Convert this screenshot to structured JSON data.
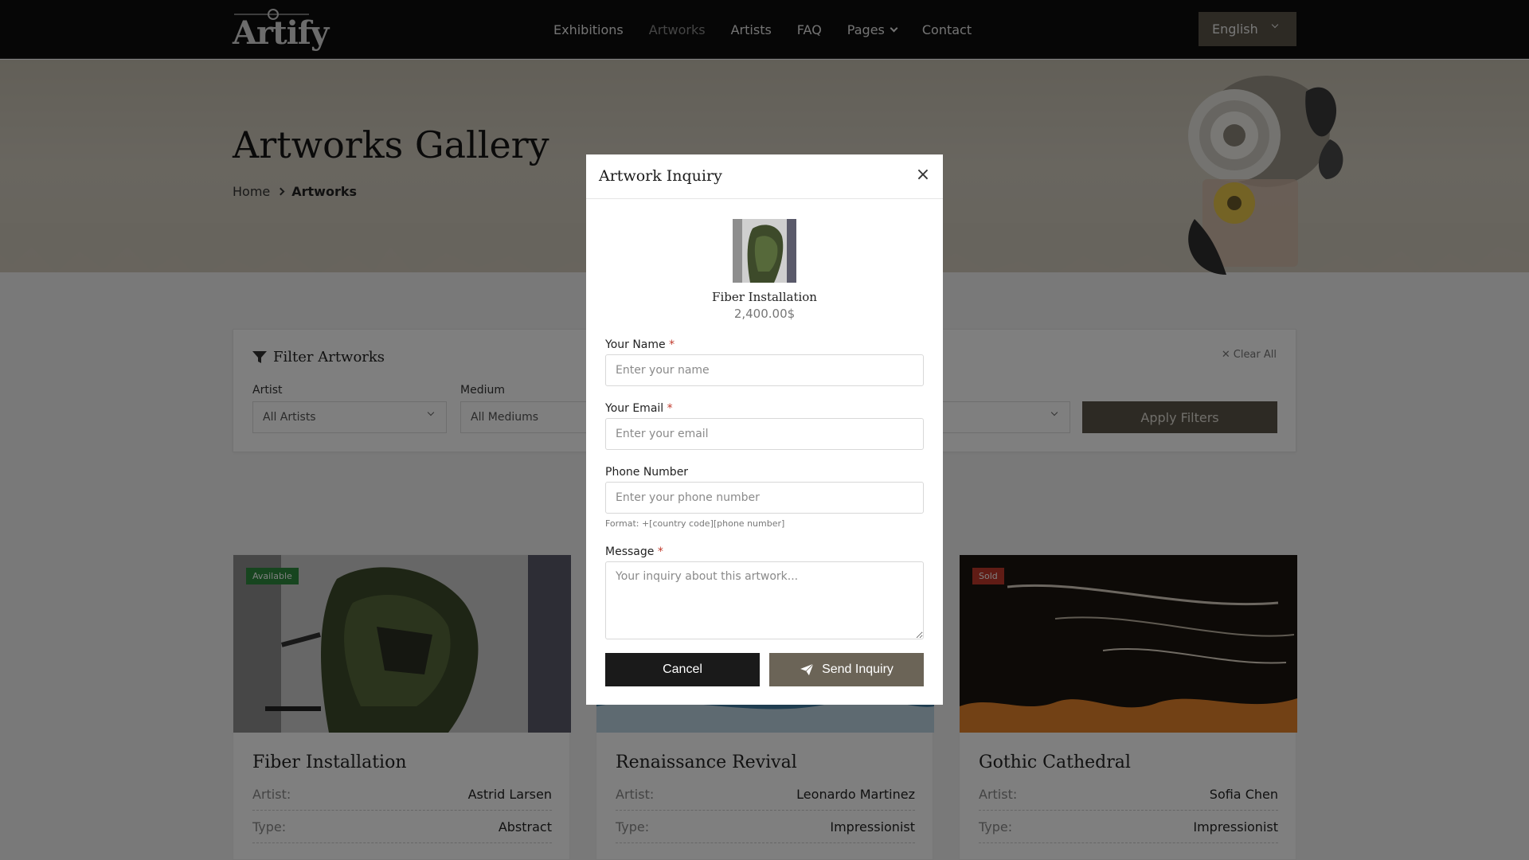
{
  "header": {
    "logo_text": "Artify",
    "nav": [
      {
        "label": "Exhibitions"
      },
      {
        "label": "Artworks"
      },
      {
        "label": "Artists"
      },
      {
        "label": "FAQ"
      },
      {
        "label": "Pages"
      },
      {
        "label": "Contact"
      }
    ],
    "language": "English"
  },
  "hero": {
    "title": "Artworks Gallery",
    "breadcrumb": {
      "home": "Home",
      "current": "Artworks"
    }
  },
  "filters": {
    "title": "Filter Artworks",
    "clear_all": "Clear All",
    "artist_label": "Artist",
    "artist_value": "All Artists",
    "medium_label": "Medium",
    "medium_value": "All Mediums",
    "apply": "Apply Filters"
  },
  "cards": [
    {
      "title": "Fiber Installation",
      "badge": "Available",
      "artist_label": "Artist:",
      "artist": "Astrid Larsen",
      "type_label": "Type:",
      "type": "Abstract"
    },
    {
      "title": "Renaissance Revival",
      "badge": "",
      "artist_label": "Artist:",
      "artist": "Leonardo Martinez",
      "type_label": "Type:",
      "type": "Impressionist"
    },
    {
      "title": "Gothic Cathedral",
      "badge": "Sold",
      "artist_label": "Artist:",
      "artist": "Sofia Chen",
      "type_label": "Type:",
      "type": "Impressionist"
    }
  ],
  "modal": {
    "title": "Artwork Inquiry",
    "close": "×",
    "artwork_name": "Fiber Installation",
    "artwork_price": "2,400.00$",
    "name_label": "Your Name",
    "name_placeholder": "Enter your name",
    "email_label": "Your Email",
    "email_placeholder": "Enter your email",
    "phone_label": "Phone Number",
    "phone_placeholder": "Enter your phone number",
    "phone_hint": "Format: +[country code][phone number]",
    "message_label": "Message",
    "message_placeholder": "Your inquiry about this artwork...",
    "required_mark": "*",
    "cancel": "Cancel",
    "send": "Send Inquiry"
  },
  "colors": {
    "accent": "#5b5548",
    "available_badge": "#2e8b3e",
    "sold_badge": "#c0392b",
    "required": "#c0392b"
  },
  "icons": {
    "close": "close-icon",
    "filter": "filter-icon",
    "send": "paper-plane-icon",
    "chevron": "chevron-down-icon"
  }
}
